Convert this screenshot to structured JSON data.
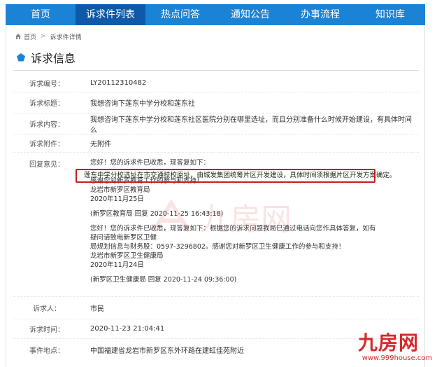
{
  "nav": {
    "items": [
      {
        "label": "首页"
      },
      {
        "label": "诉求件列表"
      },
      {
        "label": "热点问答"
      },
      {
        "label": "通知公告"
      },
      {
        "label": "办事流程"
      },
      {
        "label": "知识库"
      }
    ],
    "active_index": 1
  },
  "breadcrumb": {
    "home": "首页",
    "current": "诉求件详情"
  },
  "section_title": "诉求信息",
  "fields": {
    "number": {
      "label": "诉求编号：",
      "value": "LY20112310482"
    },
    "title": {
      "label": "诉求标题：",
      "value": "我想咨询下莲东中学分校和莲东社"
    },
    "content": {
      "label": "诉求内容：",
      "value": "我想咨询下莲东中学分校和莲东社区医院分别在哪里选址，而且分别准备什么时候开始建设，有具体时间么"
    },
    "attachment": {
      "label": "诉求附件：",
      "value": "无附件"
    },
    "person": {
      "label": "诉求人：",
      "value": "市民"
    },
    "time": {
      "label": "诉求时间：",
      "value": "2020-11-23 21:04:41"
    },
    "location": {
      "label": "事件地点：",
      "value": "中国福建省龙岩市新罗区东外环路在建虹佳苑附近"
    }
  },
  "reply": {
    "label": "回复意见：",
    "r1": {
      "line1": "您好！您的诉求件已收悉，现答复如下：",
      "highlight": "莲东中学分校选址在市交通技校原址，由城发集团统筹片区开发建设，具体时间须根据片区开发方案确定。",
      "line3": "感谢您对新罗教育工作的参与和支持！",
      "org": "龙岩市新罗区教育局",
      "date": "2020年11月25日",
      "sig": "(新罗区教育局 回复 2020-11-25 16:43:18)"
    },
    "r2": {
      "line1": "您好！您的诉求件已收悉，现答复如下：根据您的诉求问题我局已通过电话向您作具体答复，如有疑问请致电新罗区卫健",
      "line2": "局规划信息与财务股：0597-3296802。感谢您对新罗区卫生健康工作的参与和支持！",
      "org": "龙岩市新罗区卫生健康局",
      "date": "2020年11月24日",
      "sig": "(新罗区卫生健康局 回复 2020-11-24 09:36:00)"
    }
  },
  "watermark": {
    "center": "九房网",
    "logo": "九房网",
    "url": "www.999house.com"
  },
  "colors": {
    "nav": "#1b83d6",
    "nav_active": "#0e5aa8",
    "highlight_border": "#c21f1f",
    "accent_icon": "#1b83d6",
    "watermark": "#d42a2a"
  },
  "icons": {
    "breadcrumb_home": "home-icon",
    "title": "pentagon-icon"
  }
}
